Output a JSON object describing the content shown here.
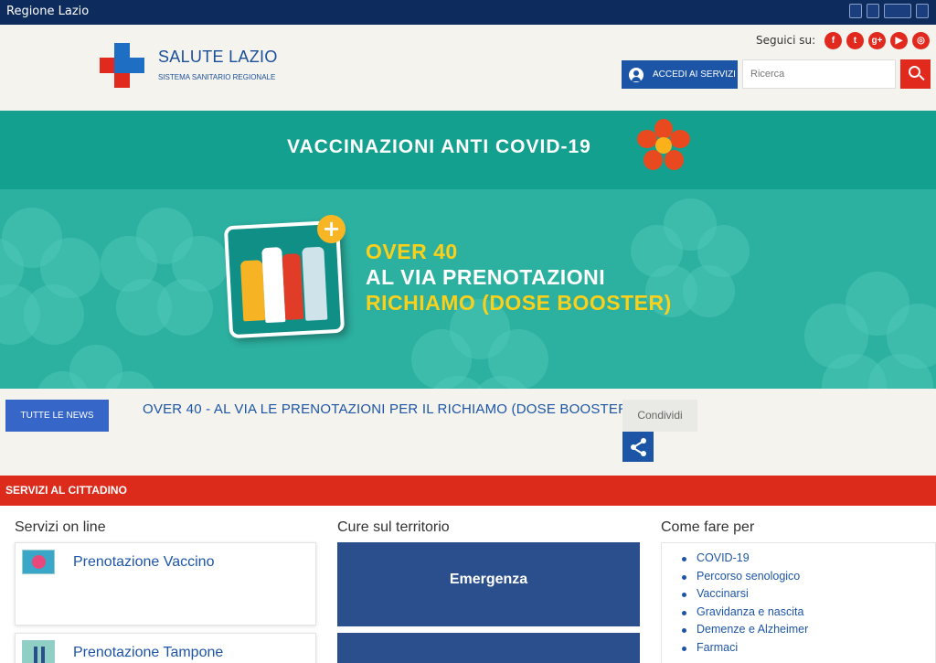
{
  "topbar": {
    "brand": "Regione Lazio"
  },
  "header": {
    "title": "SALUTE LAZIO",
    "subtitle": "SISTEMA SANITARIO REGIONALE",
    "follow_label": "Seguici su:",
    "social": [
      {
        "icon": "facebook-icon",
        "glyph": "f"
      },
      {
        "icon": "twitter-icon",
        "glyph": "t"
      },
      {
        "icon": "googleplus-icon",
        "glyph": "g+"
      },
      {
        "icon": "youtube-icon",
        "glyph": "▶"
      },
      {
        "icon": "instagram-icon",
        "glyph": "◎"
      }
    ],
    "accedi_label": "ACCEDI AI SERVIZI",
    "search_placeholder": "Ricerca"
  },
  "banner": {
    "title": "VACCINAZIONI ANTI COVID-19",
    "line1": "OVER 40",
    "line2": "AL VIA PRENOTAZIONI",
    "line3": "RICHIAMO (DOSE BOOSTER)"
  },
  "news": {
    "button_label": "TUTTE LE NEWS",
    "headline": "OVER 40 - AL VIA LE PRENOTAZIONI PER IL RICHIAMO (DOSE BOOSTER)",
    "share_label": "Condividi"
  },
  "services": {
    "section_title": "SERVIZI AL CITTADINO",
    "online_title": "Servizi on line",
    "online_items": [
      "Prenotazione Vaccino",
      "Prenotazione Tampone"
    ],
    "care_title": "Cure sul territorio",
    "care_items": [
      "Emergenza"
    ],
    "howto_title": "Come fare per",
    "howto_items": [
      "COVID-19",
      "Percorso senologico",
      "Vaccinarsi",
      "Gravidanza e nascita",
      "Demenze e Alzheimer",
      "Farmaci"
    ]
  },
  "colors": {
    "navy": "#0e2b5e",
    "red": "#dc2a1b",
    "blue": "#1d55a6",
    "teal": "#13a08e",
    "yellow": "#fbd01a"
  }
}
